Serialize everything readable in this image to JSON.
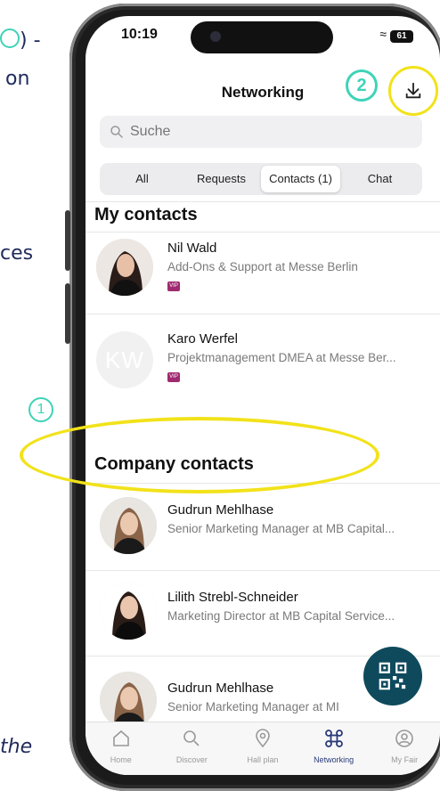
{
  "doc_fragments": {
    "line1": ") -",
    "line2": "on",
    "line3": "ces",
    "line4": "the"
  },
  "status_bar": {
    "time": "10:19",
    "battery": "61"
  },
  "header": {
    "title": "Networking",
    "badge": "2"
  },
  "search": {
    "placeholder": "Suche"
  },
  "tabs": [
    {
      "label": "All"
    },
    {
      "label": "Requests"
    },
    {
      "label": "Contacts (1)"
    },
    {
      "label": "Chat"
    }
  ],
  "my_contacts": {
    "heading": "My contacts",
    "items": [
      {
        "name": "Nil Wald",
        "role": "Add-Ons & Support at Messe Berlin",
        "badge": "VIP"
      },
      {
        "name": "Karo Werfel",
        "role": "Projektmanagement DMEA at Messe Ber...",
        "badge": "VIP",
        "initials": "KW"
      }
    ]
  },
  "annotation_badge": "1",
  "company_contacts": {
    "heading": "Company contacts",
    "items": [
      {
        "name": "Gudrun Mehlhase",
        "role": "Senior Marketing Manager at MB Capital..."
      },
      {
        "name": "Lilith Strebl-Schneider",
        "role": "Marketing Director at MB Capital Service..."
      },
      {
        "name": "Gudrun Mehlhase",
        "role": "Senior Marketing Manager at MI"
      }
    ]
  },
  "bottom_nav": [
    {
      "label": "Home",
      "icon": "home-icon"
    },
    {
      "label": "Discover",
      "icon": "search-icon"
    },
    {
      "label": "Hall plan",
      "icon": "location-pin-icon"
    },
    {
      "label": "Networking",
      "icon": "networking-icon",
      "active": true
    },
    {
      "label": "My Fair",
      "icon": "user-circle-icon"
    }
  ],
  "colors": {
    "accent": "#0f4a5c",
    "highlight": "#f2e21a",
    "teal": "#3fd3b8",
    "vip": "#a02a70"
  }
}
